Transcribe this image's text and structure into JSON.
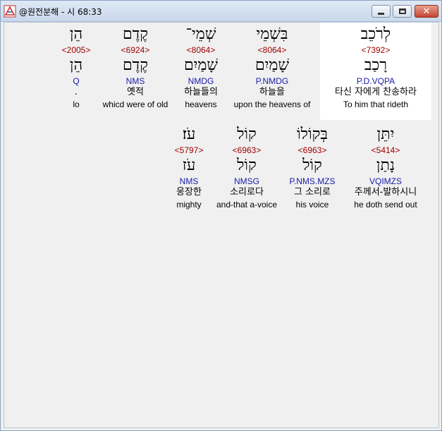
{
  "window": {
    "title": "@원전분해 - 시 68:33"
  },
  "row1": [
    {
      "hebrew": "לְרֹכֵב",
      "strong": "<7392>",
      "lemma": "רָכַב",
      "morph": "P.D.VQPA",
      "korean": "타신 자에게 찬송하라",
      "english": "To him that rideth"
    },
    {
      "hebrew": "בִּשְׁמֵי",
      "strong": "<8064>",
      "lemma": "שָׁמַיִם",
      "morph": "P.NMDG",
      "korean": "하늘을",
      "english": "upon the heavens of"
    },
    {
      "hebrew": "שְׁמֵי־",
      "strong": "<8064>",
      "lemma": "שָׁמַיִם",
      "morph": "NMDG",
      "korean": "하늘들의",
      "english": "heavens"
    },
    {
      "hebrew": "קֶדֶם",
      "strong": "<6924>",
      "lemma": "קֶדֶם",
      "morph": "NMS",
      "korean": "옛적",
      "english": "whicd were of old"
    },
    {
      "hebrew": "הֵן",
      "strong": "<2005>",
      "lemma": "הֵן",
      "morph": "Q",
      "korean": ".",
      "english": "lo"
    }
  ],
  "row2": [
    {
      "hebrew": "יִתֵּן",
      "strong": "<5414>",
      "lemma": "נָתַן",
      "morph": "VQIMZS",
      "korean": "주께서-발하시니",
      "english": "he doth send out"
    },
    {
      "hebrew": "בְּקוֹלוֹ",
      "strong": "<6963>",
      "lemma": "קוֹל",
      "morph": "P.NMS.MZS",
      "korean": "그 소리로",
      "english": "his voice"
    },
    {
      "hebrew": "קוֹל",
      "strong": "<6963>",
      "lemma": "קוֹל",
      "morph": "NMSG",
      "korean": "소리로다",
      "english": "and-that a-voice"
    },
    {
      "hebrew": "עֹז׃",
      "strong": "<5797>",
      "lemma": "עֹז",
      "morph": "NMS",
      "korean": "웅장한",
      "english": "mighty"
    }
  ]
}
